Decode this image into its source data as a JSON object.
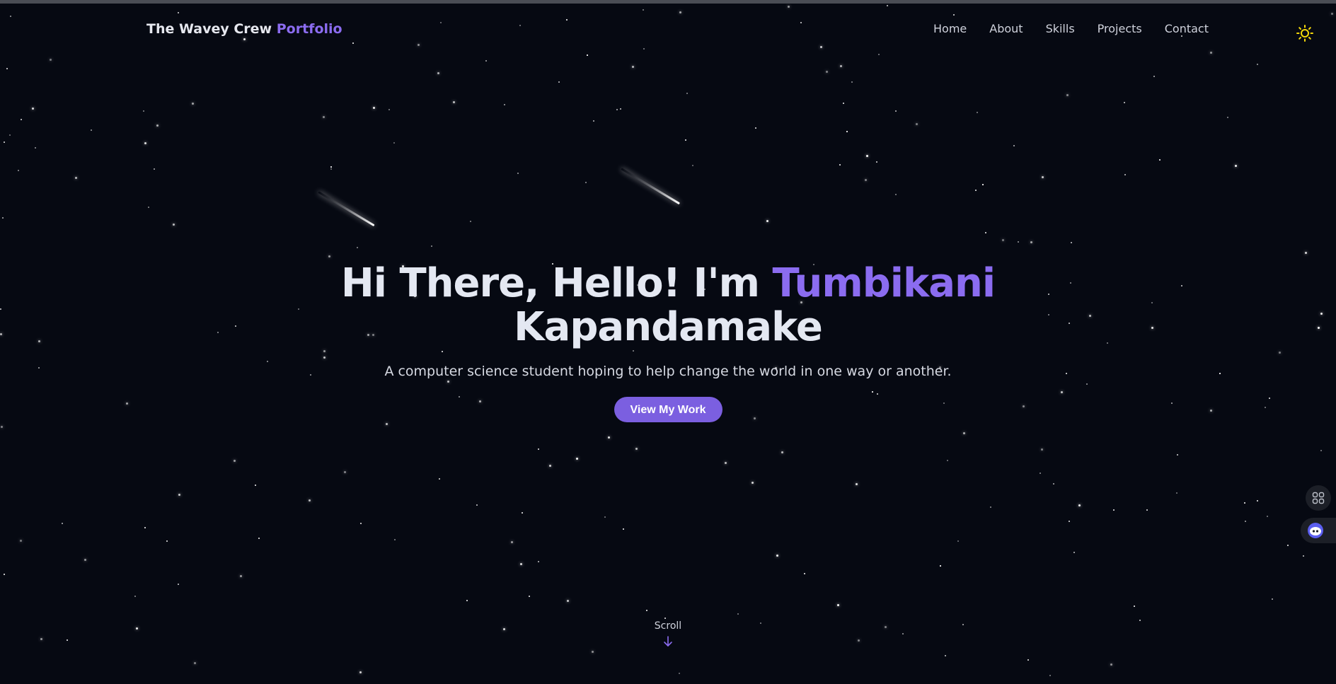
{
  "brand": {
    "name": "The Wavey Crew",
    "accent": "Portfolio"
  },
  "nav": {
    "items": [
      {
        "label": "Home"
      },
      {
        "label": "About"
      },
      {
        "label": "Skills"
      },
      {
        "label": "Projects"
      },
      {
        "label": "Contact"
      }
    ],
    "theme_toggle_icon": "sun-icon"
  },
  "hero": {
    "greeting": "Hi There, Hello! I'm",
    "first_name": "Tumbikani",
    "last_name": "Kapandamake",
    "subtitle": "A computer science student hoping to help change the world in one way or another.",
    "cta_label": "View My Work"
  },
  "scroll": {
    "label": "Scroll",
    "icon": "arrow-down-icon"
  },
  "side_widgets": {
    "apps_icon": "apps-grid-icon",
    "assistant_icon": "assistant-icon"
  },
  "colors": {
    "background": "#060912",
    "accent": "#8b6cf0",
    "button": "#7b5fe0",
    "text": "#e4e8f2",
    "sun": "#f5d90a"
  }
}
